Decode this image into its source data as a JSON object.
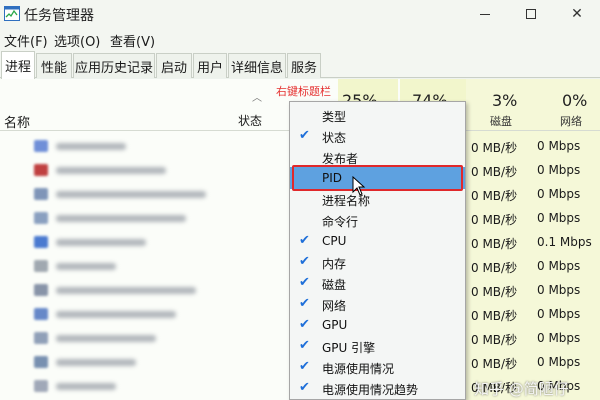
{
  "window": {
    "title": "任务管理器",
    "minimize": "",
    "maximize": "",
    "close": "✕"
  },
  "menu": [
    {
      "label": "文件(F)"
    },
    {
      "label": "选项(O)"
    },
    {
      "label": "查看(V)"
    }
  ],
  "tabs": [
    {
      "label": "进程",
      "active": true
    },
    {
      "label": "性能"
    },
    {
      "label": "应用历史记录"
    },
    {
      "label": "启动"
    },
    {
      "label": "用户"
    },
    {
      "label": "详细信息"
    },
    {
      "label": "服务"
    }
  ],
  "header": {
    "name": "名称",
    "status": "状态",
    "cpu_pct": "25%",
    "mem_pct": "74%",
    "disk_pct": "3%",
    "disk_label": "磁盘",
    "net_pct": "0%",
    "net_label": "网络"
  },
  "annotation": "右键标题栏",
  "rows": [
    {
      "disk": "0 MB/秒",
      "net": "0 Mbps",
      "icon_color": "#6f8fd8"
    },
    {
      "disk": "0 MB/秒",
      "net": "0 Mbps",
      "icon_color": "#c04040"
    },
    {
      "disk": "0 MB/秒",
      "net": "0 Mbps",
      "icon_color": "#7f95b8"
    },
    {
      "disk": "0 MB/秒",
      "net": "0 Mbps",
      "icon_color": "#8aa0c0"
    },
    {
      "disk": "0 MB/秒",
      "net": "0.1 Mbps",
      "icon_color": "#4a7ad0"
    },
    {
      "disk": "0 MB/秒",
      "net": "0 Mbps",
      "icon_color": "#a0a8b0"
    },
    {
      "disk": "0 MB/秒",
      "net": "0 Mbps",
      "icon_color": "#8894a8"
    },
    {
      "disk": "0 MB/秒",
      "net": "0 Mbps",
      "icon_color": "#6688c8"
    },
    {
      "disk": "0 MB/秒",
      "net": "0 Mbps",
      "icon_color": "#90a0b8"
    },
    {
      "disk": "0 MB/秒",
      "net": "0 Mbps",
      "icon_color": "#7890b0"
    },
    {
      "disk": "0 MB/秒",
      "net": "0 Mbps",
      "icon_color": "#a0a8b8"
    }
  ],
  "context_menu": [
    {
      "label": "类型",
      "checked": false
    },
    {
      "label": "状态",
      "checked": true
    },
    {
      "label": "发布者",
      "checked": false
    },
    {
      "label": "PID",
      "checked": false,
      "highlighted": true
    },
    {
      "label": "进程名称",
      "checked": false
    },
    {
      "label": "命令行",
      "checked": false
    },
    {
      "label": "CPU",
      "checked": true
    },
    {
      "label": "内存",
      "checked": true
    },
    {
      "label": "磁盘",
      "checked": true
    },
    {
      "label": "网络",
      "checked": true
    },
    {
      "label": "GPU",
      "checked": true
    },
    {
      "label": "GPU 引擎",
      "checked": true
    },
    {
      "label": "电源使用情况",
      "checked": true
    },
    {
      "label": "电源使用情况趋势",
      "checked": true
    }
  ],
  "watermark": "知乎 @简陋仔",
  "colors": {
    "accent": "#5ea1e0",
    "check": "#1e6fd9",
    "annotation_red": "#e0282b",
    "column_highlight": "#f2f6cc"
  }
}
